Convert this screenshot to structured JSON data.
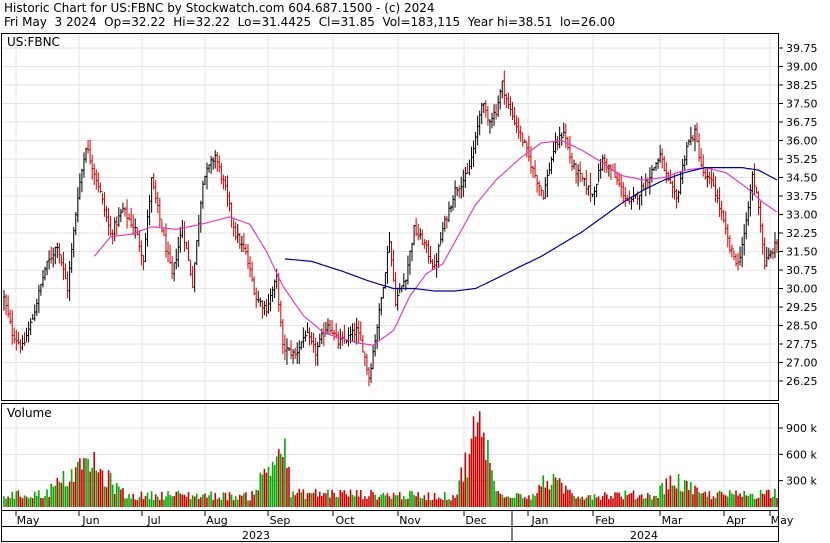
{
  "header": {
    "line1": "Historic Chart for US:FBNC by Stockwatch.com 604.687.1500 - (c) 2024",
    "line2": "Fri May  3 2024  Op=32.22  Hi=32.22  Lo=31.4425  Cl=31.85  Vol=183,115  Year hi=38.51  lo=26.00"
  },
  "symbol_label": "US:FBNC",
  "volume_label": "Volume",
  "colors": {
    "up": "#000000",
    "down": "#cc0000",
    "vol_up": "#00aa00",
    "vol_down": "#cc0000",
    "ma_short": "#e040c0",
    "ma_long": "#000099",
    "grid": "#c8c8c8"
  },
  "chart_data": {
    "type": "line",
    "title": "Historic Chart for US:FBNC",
    "price_axis": {
      "ticks": [
        "39.75",
        "39.00",
        "38.25",
        "37.50",
        "36.75",
        "36.00",
        "35.25",
        "34.50",
        "33.75",
        "33.00",
        "32.25",
        "31.50",
        "30.75",
        "30.00",
        "29.25",
        "28.50",
        "27.75",
        "27.00",
        "26.25"
      ],
      "ylim": [
        26.25,
        39.75
      ]
    },
    "volume_axis": {
      "ticks": [
        "900 k",
        "600 k",
        "300 k"
      ],
      "ylim": [
        0,
        1100
      ]
    },
    "months": [
      "May",
      "Jun",
      "Jul",
      "Aug",
      "Sep",
      "Oct",
      "Nov",
      "Dec",
      "Jan",
      "Feb",
      "Mar",
      "Apr",
      "May"
    ],
    "years": [
      "2023",
      "2024"
    ],
    "close_anchors": [
      [
        0,
        29.6
      ],
      [
        4,
        28.2
      ],
      [
        9,
        27.6
      ],
      [
        14,
        28.8
      ],
      [
        20,
        30.8
      ],
      [
        26,
        31.8
      ],
      [
        31,
        30.0
      ],
      [
        36,
        33.8
      ],
      [
        40,
        35.8
      ],
      [
        46,
        34.2
      ],
      [
        52,
        32.2
      ],
      [
        58,
        33.2
      ],
      [
        64,
        32.4
      ],
      [
        68,
        31.2
      ],
      [
        72,
        34.4
      ],
      [
        76,
        32.8
      ],
      [
        82,
        30.5
      ],
      [
        87,
        32.5
      ],
      [
        92,
        30.2
      ],
      [
        97,
        34.4
      ],
      [
        103,
        35.4
      ],
      [
        108,
        34.0
      ],
      [
        113,
        32.2
      ],
      [
        118,
        31.4
      ],
      [
        123,
        29.6
      ],
      [
        128,
        29.2
      ],
      [
        133,
        30.4
      ],
      [
        136,
        27.6
      ],
      [
        142,
        27.3
      ],
      [
        147,
        28.2
      ],
      [
        152,
        27.4
      ],
      [
        158,
        28.6
      ],
      [
        163,
        27.8
      ],
      [
        168,
        28.0
      ],
      [
        172,
        28.3
      ],
      [
        175,
        27.6
      ],
      [
        178,
        26.4
      ],
      [
        183,
        29.0
      ],
      [
        188,
        32.0
      ],
      [
        191,
        29.5
      ],
      [
        196,
        30.5
      ],
      [
        200,
        32.4
      ],
      [
        205,
        31.8
      ],
      [
        210,
        30.8
      ],
      [
        214,
        32.4
      ],
      [
        220,
        34.0
      ],
      [
        226,
        34.6
      ],
      [
        230,
        36.0
      ],
      [
        233,
        37.6
      ],
      [
        236,
        36.8
      ],
      [
        240,
        37.2
      ],
      [
        243,
        38.3
      ],
      [
        246,
        37.4
      ],
      [
        250,
        36.6
      ],
      [
        254,
        35.8
      ],
      [
        258,
        34.8
      ],
      [
        263,
        33.8
      ],
      [
        268,
        35.6
      ],
      [
        273,
        36.4
      ],
      [
        277,
        35.0
      ],
      [
        282,
        34.4
      ],
      [
        287,
        33.8
      ],
      [
        292,
        35.2
      ],
      [
        296,
        34.8
      ],
      [
        300,
        34.2
      ],
      [
        305,
        33.4
      ],
      [
        310,
        33.9
      ],
      [
        315,
        34.6
      ],
      [
        320,
        35.4
      ],
      [
        324,
        34.3
      ],
      [
        328,
        33.6
      ],
      [
        333,
        35.8
      ],
      [
        337,
        36.3
      ],
      [
        341,
        34.6
      ],
      [
        346,
        34.2
      ],
      [
        350,
        33.0
      ],
      [
        354,
        31.6
      ],
      [
        358,
        31.0
      ],
      [
        362,
        32.6
      ],
      [
        365,
        34.6
      ],
      [
        368,
        33.4
      ],
      [
        371,
        31.0
      ],
      [
        374,
        31.4
      ],
      [
        377,
        31.85
      ]
    ],
    "volume_anchors": [
      [
        0,
        140
      ],
      [
        20,
        160
      ],
      [
        41,
        550
      ],
      [
        60,
        130
      ],
      [
        80,
        150
      ],
      [
        100,
        140
      ],
      [
        120,
        130
      ],
      [
        137,
        780
      ],
      [
        140,
        160
      ],
      [
        160,
        170
      ],
      [
        180,
        150
      ],
      [
        200,
        140
      ],
      [
        220,
        130
      ],
      [
        232,
        1090
      ],
      [
        240,
        180
      ],
      [
        260,
        140
      ],
      [
        263,
        360
      ],
      [
        280,
        140
      ],
      [
        300,
        150
      ],
      [
        318,
        140
      ],
      [
        325,
        360
      ],
      [
        340,
        150
      ],
      [
        360,
        150
      ],
      [
        377,
        183
      ]
    ],
    "ma_short_anchors": [
      [
        44,
        31.3
      ],
      [
        52,
        32.1
      ],
      [
        62,
        32.2
      ],
      [
        72,
        32.5
      ],
      [
        84,
        32.4
      ],
      [
        96,
        32.6
      ],
      [
        110,
        32.9
      ],
      [
        120,
        32.6
      ],
      [
        128,
        31.5
      ],
      [
        136,
        30.1
      ],
      [
        146,
        28.9
      ],
      [
        156,
        28.2
      ],
      [
        164,
        28.0
      ],
      [
        172,
        27.8
      ],
      [
        180,
        27.7
      ],
      [
        190,
        28.3
      ],
      [
        198,
        29.7
      ],
      [
        206,
        30.6
      ],
      [
        214,
        31.0
      ],
      [
        222,
        32.2
      ],
      [
        230,
        33.4
      ],
      [
        240,
        34.4
      ],
      [
        252,
        35.3
      ],
      [
        262,
        35.9
      ],
      [
        272,
        36.0
      ],
      [
        282,
        35.6
      ],
      [
        292,
        35.1
      ],
      [
        300,
        34.6
      ],
      [
        312,
        34.4
      ],
      [
        322,
        34.5
      ],
      [
        332,
        34.8
      ],
      [
        342,
        34.9
      ],
      [
        352,
        34.7
      ],
      [
        362,
        34.1
      ],
      [
        370,
        33.5
      ],
      [
        377,
        33.1
      ]
    ],
    "ma_long_anchors": [
      [
        137,
        31.2
      ],
      [
        150,
        31.1
      ],
      [
        165,
        30.7
      ],
      [
        178,
        30.3
      ],
      [
        190,
        30.0
      ],
      [
        200,
        30.0
      ],
      [
        210,
        29.9
      ],
      [
        220,
        29.9
      ],
      [
        230,
        30.0
      ],
      [
        240,
        30.4
      ],
      [
        252,
        30.9
      ],
      [
        262,
        31.3
      ],
      [
        272,
        31.8
      ],
      [
        282,
        32.3
      ],
      [
        292,
        32.9
      ],
      [
        302,
        33.5
      ],
      [
        312,
        34.0
      ],
      [
        322,
        34.4
      ],
      [
        332,
        34.7
      ],
      [
        342,
        34.9
      ],
      [
        352,
        34.9
      ],
      [
        360,
        34.9
      ],
      [
        368,
        34.8
      ],
      [
        377,
        34.4
      ]
    ]
  }
}
